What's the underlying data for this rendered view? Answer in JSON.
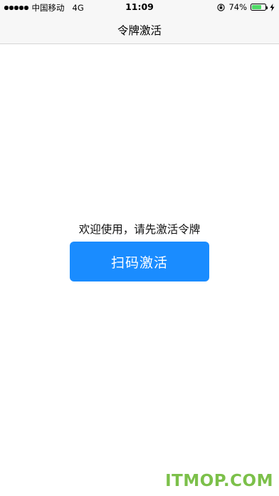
{
  "status_bar": {
    "carrier": "中国移动",
    "network": "4G",
    "time": "11:09",
    "battery_percent": "74%",
    "battery_level": 0.74,
    "battery_color": "#4cd964"
  },
  "nav": {
    "title": "令牌激活"
  },
  "main": {
    "welcome_text": "欢迎使用，请先激活令牌",
    "scan_button_label": "扫码激活",
    "accent_color": "#1a8cff"
  },
  "watermark": {
    "text": "ITMOP.COM"
  },
  "icons": {
    "signal": "signal-dots-icon",
    "rotation_lock": "rotation-lock-icon",
    "battery": "battery-icon",
    "charging": "charging-bolt-icon"
  }
}
